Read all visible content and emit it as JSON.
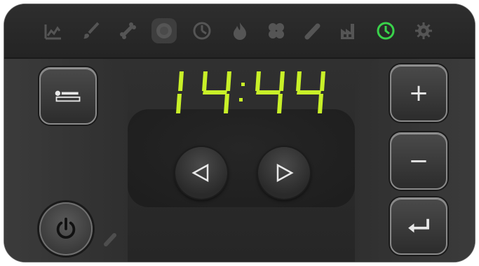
{
  "display": {
    "time": "14:44",
    "digit_color": "#c8f028"
  },
  "status_icons": [
    {
      "name": "chart-icon",
      "active": false
    },
    {
      "name": "brush-icon",
      "active": false
    },
    {
      "name": "bone-icon",
      "active": false
    },
    {
      "name": "gear-round-icon",
      "active": false
    },
    {
      "name": "clock-dial-icon",
      "active": false
    },
    {
      "name": "flame-icon",
      "active": false
    },
    {
      "name": "fan-icon",
      "active": false
    },
    {
      "name": "pellet-icon",
      "active": false
    },
    {
      "name": "factory-icon",
      "active": false
    },
    {
      "name": "clock-icon",
      "active": true,
      "color": "#39d24a"
    },
    {
      "name": "settings-icon",
      "active": false
    }
  ],
  "buttons": {
    "plus_label": "+",
    "minus_label": "−"
  },
  "colors": {
    "panel": "#2b2b2b",
    "icon_inactive": "#4e4e4e",
    "icon_active": "#39d24a"
  }
}
